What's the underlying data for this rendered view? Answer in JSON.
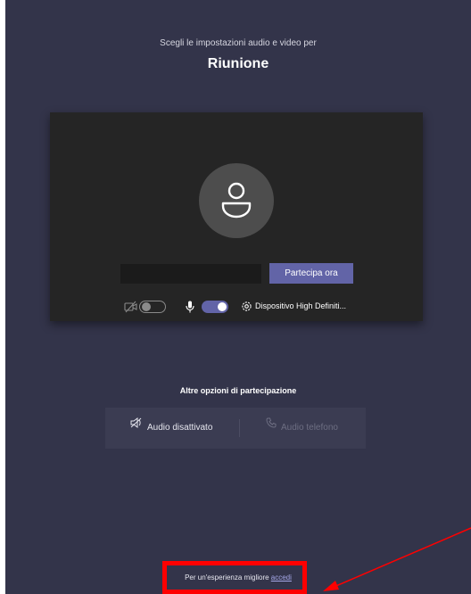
{
  "header": {
    "subtitle": "Scegli le impostazioni audio e video per",
    "title": "Riunione"
  },
  "preview": {
    "name_input": {
      "value": "",
      "placeholder": ""
    },
    "join_button_label": "Partecipa ora",
    "video_toggle": {
      "state": "off"
    },
    "mic_toggle": {
      "state": "on"
    },
    "device_label": "Dispositivo High Definiti..."
  },
  "options": {
    "heading": "Altre opzioni di partecipazione",
    "audio_off_label": "Audio disattivato",
    "phone_audio_label": "Audio telefono"
  },
  "footer": {
    "text": "Per un'esperienza migliore ",
    "link_label": "accedi"
  },
  "colors": {
    "background": "#33344a",
    "preview_background": "#252525",
    "accent": "#6264a7",
    "link": "#a6a8e8",
    "annotation": "#ff0000"
  },
  "icons": {
    "avatar": "person-icon",
    "video_off": "video-off-icon",
    "mic": "microphone-icon",
    "device": "gear-icon",
    "audio_off": "speaker-off-icon",
    "phone": "phone-icon"
  }
}
